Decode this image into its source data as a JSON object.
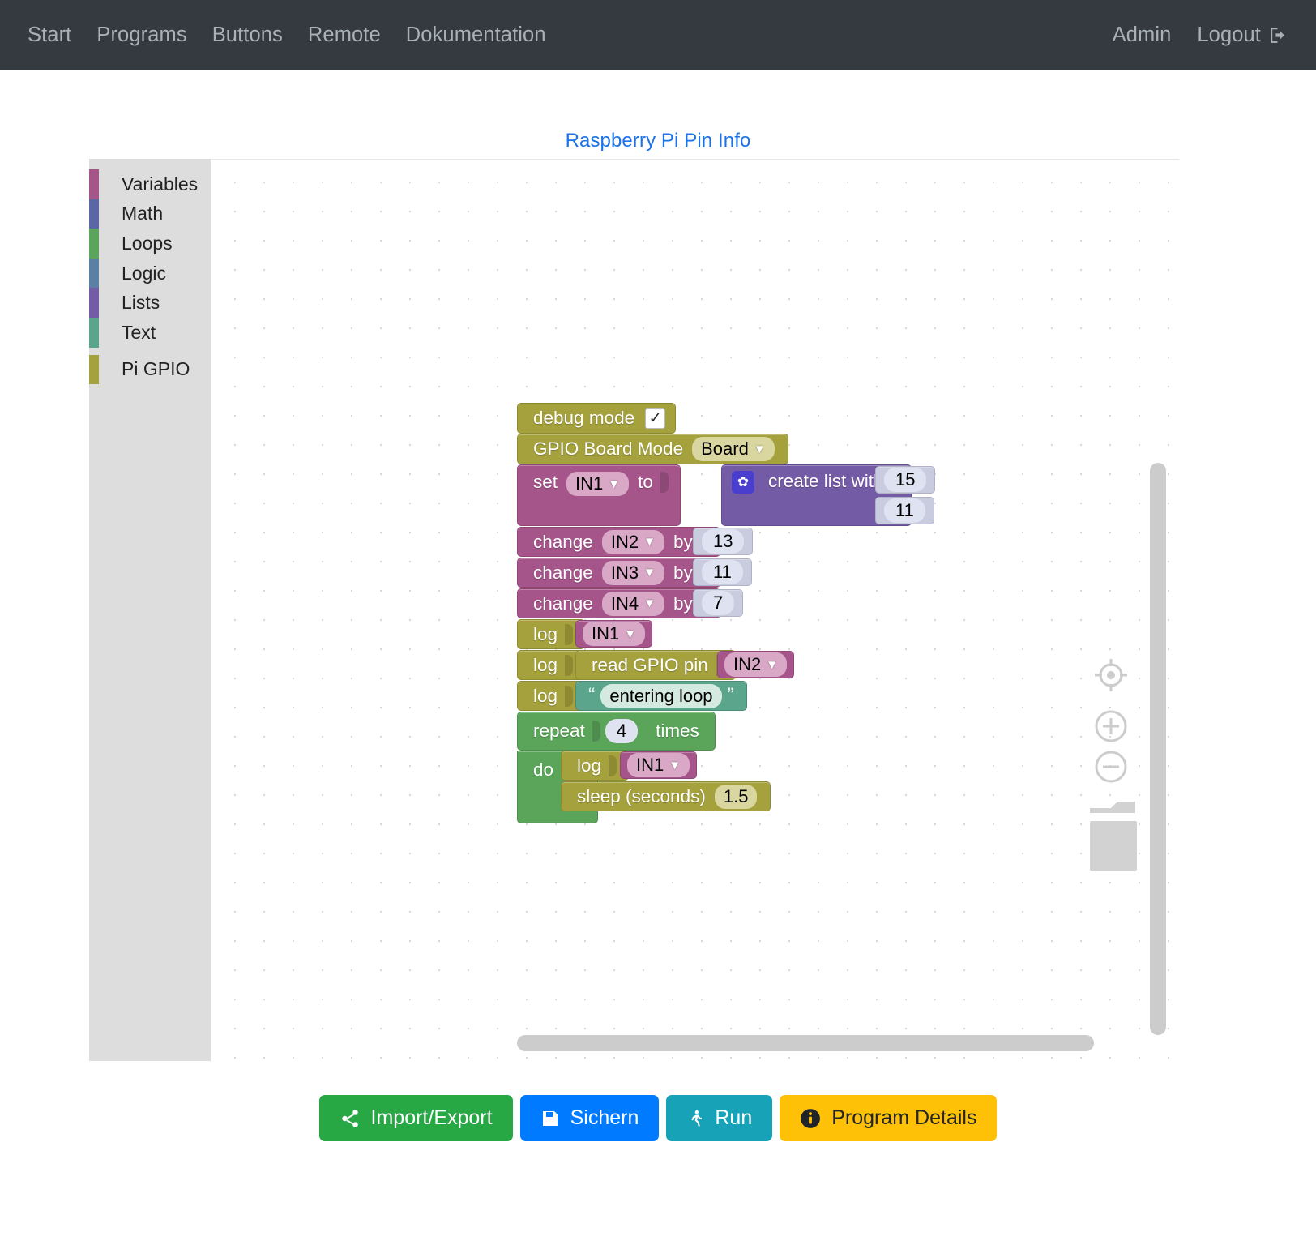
{
  "navbar": {
    "left_links": [
      {
        "label": "Start",
        "name": "nav-start"
      },
      {
        "label": "Programs",
        "name": "nav-programs"
      },
      {
        "label": "Buttons",
        "name": "nav-buttons"
      },
      {
        "label": "Remote",
        "name": "nav-remote"
      },
      {
        "label": "Dokumentation",
        "name": "nav-dokumentation"
      }
    ],
    "user": "Admin",
    "logout": "Logout"
  },
  "workspace": {
    "title": "Raspberry Pi Pin Info"
  },
  "toolbox": {
    "categories": [
      {
        "label": "Variables",
        "color": "#a5558a"
      },
      {
        "label": "Math",
        "color": "#5b67a5"
      },
      {
        "label": "Loops",
        "color": "#5ba55b"
      },
      {
        "label": "Logic",
        "color": "#5b80a5"
      },
      {
        "label": "Lists",
        "color": "#745ba5"
      },
      {
        "label": "Text",
        "color": "#5ba58c"
      },
      {
        "label": "Pi GPIO",
        "color": "#a5a13c"
      }
    ]
  },
  "blocks": {
    "debug_mode": {
      "label": "debug mode",
      "checked": "✓"
    },
    "board_mode": {
      "label": "GPIO Board Mode",
      "value": "Board"
    },
    "set_block": {
      "label": "set",
      "variable": "IN1",
      "to": "to"
    },
    "create_list": {
      "label": "create list with",
      "items": [
        "15",
        "11"
      ]
    },
    "change_blocks": [
      {
        "label": "change",
        "variable": "IN2",
        "by": "by",
        "value": "13"
      },
      {
        "label": "change",
        "variable": "IN3",
        "by": "by",
        "value": "11"
      },
      {
        "label": "change",
        "variable": "IN4",
        "by": "by",
        "value": "7"
      }
    ],
    "log_var": {
      "label": "log",
      "variable": "IN1"
    },
    "log_read": {
      "label": "log",
      "inner_label": "read GPIO pin",
      "variable": "IN2"
    },
    "log_text": {
      "label": "log",
      "text": "entering loop"
    },
    "repeat": {
      "label": "repeat",
      "times_value": "4",
      "times_label": "times",
      "do_label": "do"
    },
    "loop_log": {
      "label": "log",
      "variable": "IN1"
    },
    "sleep": {
      "label": "sleep (seconds)",
      "value": "1.5"
    }
  },
  "zoom_controls": {
    "center": "center-target-icon",
    "zoom_in": "plus-icon",
    "zoom_out": "minus-icon",
    "trash": "trashcan-icon"
  },
  "actions": [
    {
      "label": "Import/Export",
      "icon": "share-icon",
      "color": "#28a745"
    },
    {
      "label": "Sichern",
      "icon": "save-icon",
      "color": "#007bff"
    },
    {
      "label": "Run",
      "icon": "run-icon",
      "color": "#17a2b8"
    },
    {
      "label": "Program Details",
      "icon": "info-icon",
      "color": "#ffc107"
    }
  ]
}
